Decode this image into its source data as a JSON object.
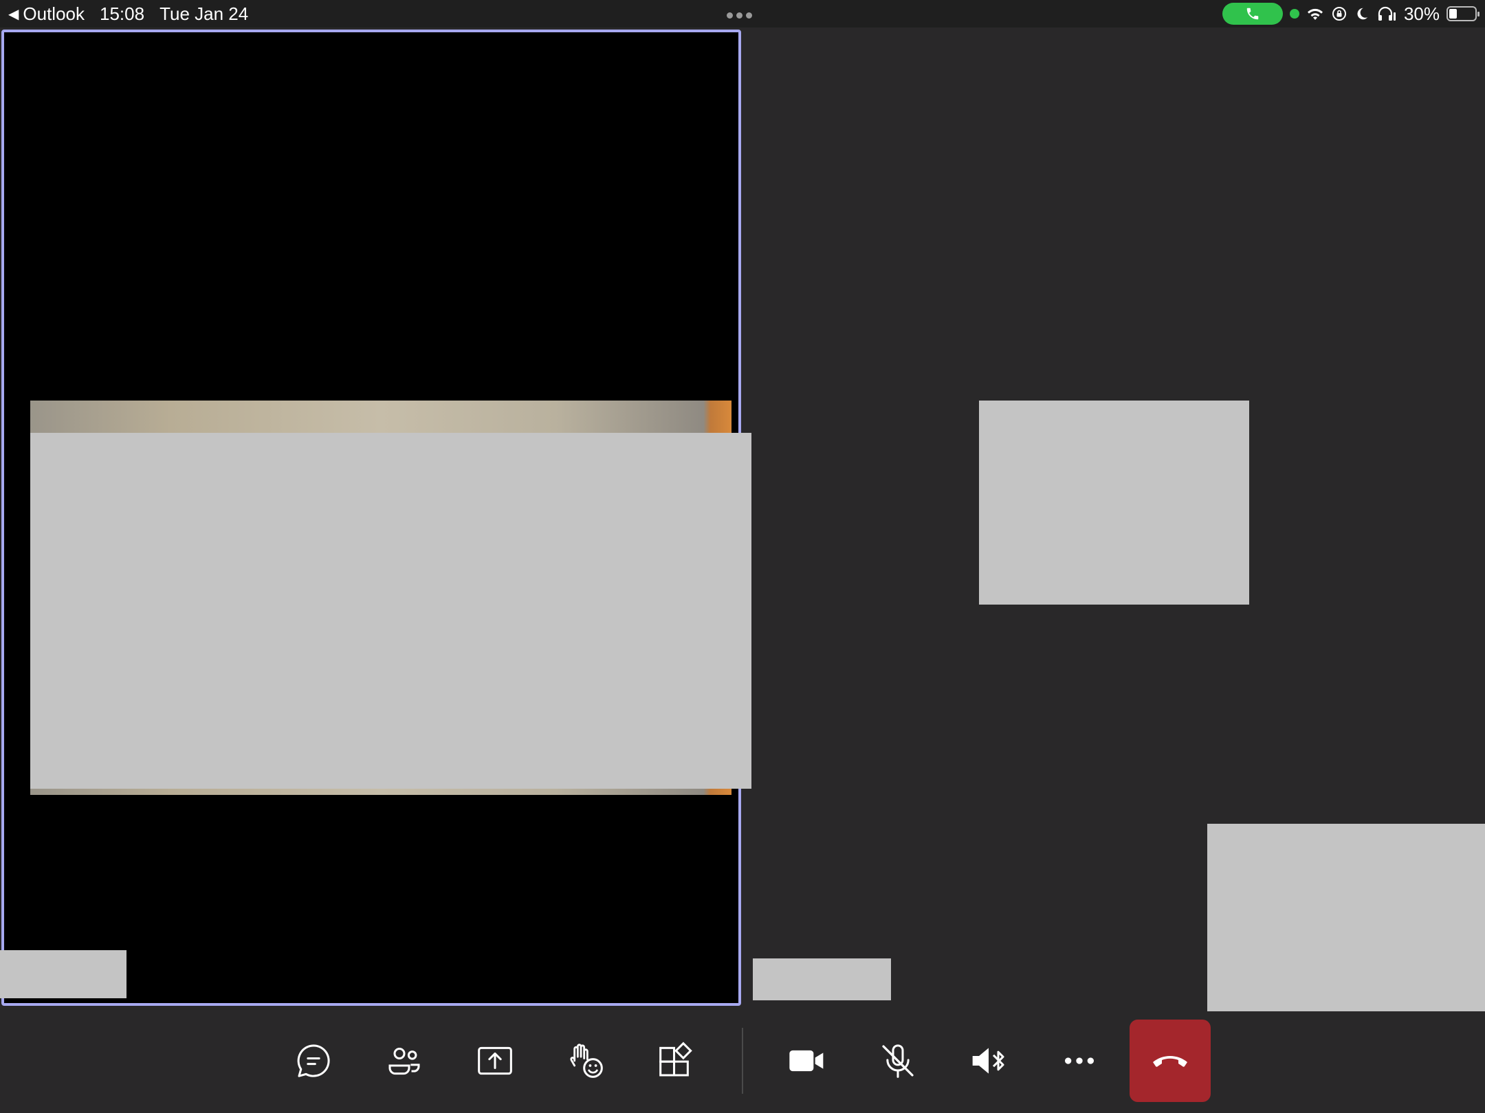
{
  "status_bar": {
    "back_app": "Outlook",
    "time": "15:08",
    "date": "Tue Jan 24",
    "battery_percent": "30%",
    "battery_level": 0.3
  },
  "toolbar": {
    "buttons": [
      {
        "name": "chat",
        "icon": "chat-icon"
      },
      {
        "name": "participants",
        "icon": "people-icon"
      },
      {
        "name": "share",
        "icon": "share-screen-icon"
      },
      {
        "name": "react",
        "icon": "raise-hand-reaction-icon"
      },
      {
        "name": "apps",
        "icon": "apps-icon"
      },
      {
        "name": "camera",
        "icon": "video-camera-icon"
      },
      {
        "name": "mute",
        "icon": "microphone-off-icon"
      },
      {
        "name": "audio",
        "icon": "bluetooth-speaker-icon"
      },
      {
        "name": "more",
        "icon": "more-icon"
      },
      {
        "name": "leave",
        "icon": "hang-up-icon"
      }
    ]
  },
  "colors": {
    "active_speaker_border": "#a7a9f0",
    "hangup_red": "#a4262c",
    "call_green": "#30c24c",
    "stage_bg": "#292829"
  }
}
